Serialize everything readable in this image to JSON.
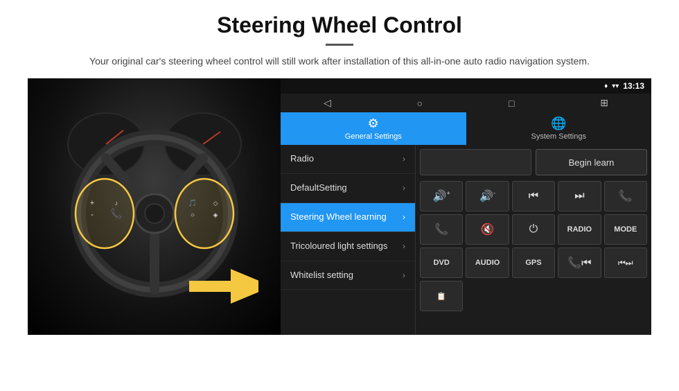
{
  "page": {
    "title": "Steering Wheel Control",
    "subtitle": "Your original car's steering wheel control will still work after installation of this all-in-one auto radio navigation system."
  },
  "status_bar": {
    "location_icon": "♦",
    "wifi_icon": "▼",
    "time": "13:13"
  },
  "nav_bar": {
    "back": "◁",
    "home": "○",
    "square": "□",
    "grid": "⊞"
  },
  "tabs": [
    {
      "id": "general",
      "label": "General Settings",
      "icon": "⚙",
      "active": true
    },
    {
      "id": "system",
      "label": "System Settings",
      "icon": "🌐",
      "active": false
    }
  ],
  "menu_items": [
    {
      "id": "radio",
      "label": "Radio",
      "active": false
    },
    {
      "id": "default",
      "label": "DefaultSetting",
      "active": false
    },
    {
      "id": "steering",
      "label": "Steering Wheel learning",
      "active": true
    },
    {
      "id": "tricoloured",
      "label": "Tricoloured light settings",
      "active": false
    },
    {
      "id": "whitelist",
      "label": "Whitelist setting",
      "active": false
    }
  ],
  "controls": {
    "begin_learn_label": "Begin learn",
    "row1": [
      {
        "icon": "🔊+",
        "label": "vol-up"
      },
      {
        "icon": "🔊-",
        "label": "vol-down"
      },
      {
        "icon": "⏮",
        "label": "prev-track"
      },
      {
        "icon": "⏭",
        "label": "next-track"
      },
      {
        "icon": "📞",
        "label": "phone"
      }
    ],
    "row2": [
      {
        "icon": "📞",
        "label": "answer"
      },
      {
        "icon": "🔇",
        "label": "mute"
      },
      {
        "icon": "⏻",
        "label": "power"
      },
      {
        "text": "RADIO",
        "label": "radio-btn"
      },
      {
        "text": "MODE",
        "label": "mode-btn"
      }
    ],
    "row3": [
      {
        "text": "DVD",
        "label": "dvd-btn"
      },
      {
        "text": "AUDIO",
        "label": "audio-btn"
      },
      {
        "text": "GPS",
        "label": "gps-btn"
      },
      {
        "icon": "📞⏮",
        "label": "phone-prev"
      },
      {
        "icon": "⏮⏭",
        "label": "skip"
      }
    ],
    "row4": [
      {
        "icon": "📋",
        "label": "list"
      }
    ]
  }
}
